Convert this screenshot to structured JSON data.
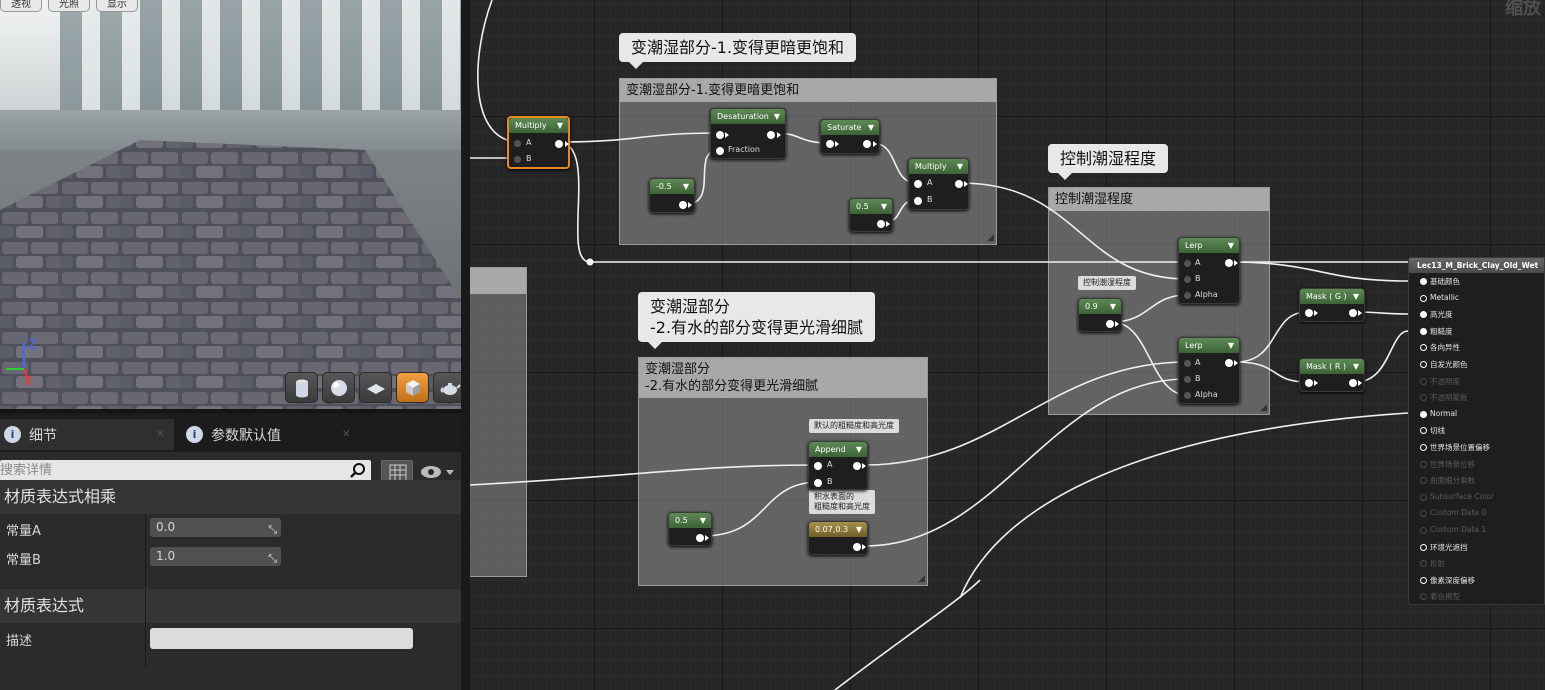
{
  "viewport": {
    "toolbar": [
      "透视",
      "光照",
      "显示"
    ],
    "gizmo_axes": {
      "z": "Z",
      "x": "X"
    },
    "preview_shapes": [
      "cylinder-icon",
      "sphere-icon",
      "plane-icon",
      "cube-icon",
      "teapot-icon"
    ],
    "active_shape": "cube-icon"
  },
  "details": {
    "tabs": [
      {
        "label": "细节",
        "active": true
      },
      {
        "label": "参数默认值",
        "active": false
      }
    ],
    "search_placeholder": "搜索详情",
    "sections": [
      {
        "title": "材质表达式相乘",
        "rows": [
          {
            "label": "常量A",
            "value": "0.0"
          },
          {
            "label": "常量B",
            "value": "1.0"
          }
        ]
      },
      {
        "title": "材质表达式",
        "rows": [
          {
            "label": "描述",
            "value": ""
          }
        ]
      }
    ]
  },
  "graph": {
    "zoom_label": "缩放",
    "comments": {
      "darken": {
        "bubble": "变潮湿部分-1.变得更暗更饱和",
        "title": "变潮湿部分-1.变得更暗更饱和"
      },
      "smooth": {
        "bubble": "变潮湿部分\n-2.有水的部分变得更光滑细腻",
        "title": "变潮湿部分\n-2.有水的部分变得更光滑细腻"
      },
      "control": {
        "bubble": "控制潮湿程度",
        "title": "控制潮湿程度"
      }
    },
    "small_bubbles": {
      "default_roughness": "默认的粗糙度和高光度",
      "water_roughness": "积水表面的\n粗糙度和高光度",
      "wet_amount": "控制潮湿程度"
    },
    "nodes": {
      "multiply1": {
        "title": "Multiply",
        "pins": [
          "A",
          "B"
        ]
      },
      "desaturation": {
        "title": "Desaturation",
        "pins": [
          "",
          "Fraction"
        ]
      },
      "saturate": {
        "title": "Saturate"
      },
      "multiply2": {
        "title": "Multiply",
        "pins": [
          "A",
          "B"
        ]
      },
      "const_neg05": {
        "title": "-0.5"
      },
      "const_05a": {
        "title": "0.5"
      },
      "const_05b": {
        "title": "0.5"
      },
      "const_09": {
        "title": "0.9"
      },
      "lerp1": {
        "title": "Lerp",
        "pins": [
          "A",
          "B",
          "Alpha"
        ]
      },
      "lerp2": {
        "title": "Lerp",
        "pins": [
          "A",
          "B",
          "Alpha"
        ]
      },
      "append": {
        "title": "Append",
        "pins": [
          "A",
          "B"
        ]
      },
      "const_007_03": {
        "title": "0.07,0.3"
      },
      "mask_g": {
        "title": "Mask ( G )"
      },
      "mask_r": {
        "title": "Mask ( R )"
      }
    },
    "result_node": {
      "title": "Lec13_M_Brick_Clay_Old_Wet",
      "inputs": [
        {
          "label": "基础颜色",
          "enabled": true,
          "connected": true
        },
        {
          "label": "Metallic",
          "enabled": true,
          "connected": false
        },
        {
          "label": "高光度",
          "enabled": true,
          "connected": true
        },
        {
          "label": "粗糙度",
          "enabled": true,
          "connected": true
        },
        {
          "label": "各向异性",
          "enabled": true,
          "connected": false
        },
        {
          "label": "自发光颜色",
          "enabled": true,
          "connected": false
        },
        {
          "label": "不透明度",
          "enabled": false,
          "connected": false
        },
        {
          "label": "不透明蒙版",
          "enabled": false,
          "connected": false
        },
        {
          "label": "Normal",
          "enabled": true,
          "connected": true
        },
        {
          "label": "切线",
          "enabled": true,
          "connected": false
        },
        {
          "label": "世界场景位置偏移",
          "enabled": true,
          "connected": false
        },
        {
          "label": "世界场景位移",
          "enabled": false,
          "connected": false
        },
        {
          "label": "曲面细分乘数",
          "enabled": false,
          "connected": false
        },
        {
          "label": "Subsurface Color",
          "enabled": false,
          "connected": false
        },
        {
          "label": "Custom Data 0",
          "enabled": false,
          "connected": false
        },
        {
          "label": "Custom Data 1",
          "enabled": false,
          "connected": false
        },
        {
          "label": "环境光遮挡",
          "enabled": true,
          "connected": false
        },
        {
          "label": "折射",
          "enabled": false,
          "connected": false
        },
        {
          "label": "像素深度偏移",
          "enabled": true,
          "connected": false
        },
        {
          "label": "着色模型",
          "enabled": false,
          "connected": false
        }
      ]
    }
  },
  "colors": {
    "graph_bg": "#262626",
    "node_header_green": "#4f7a48",
    "selected_border": "#e88a1e",
    "constant_vector_gold": "#8a7638"
  }
}
